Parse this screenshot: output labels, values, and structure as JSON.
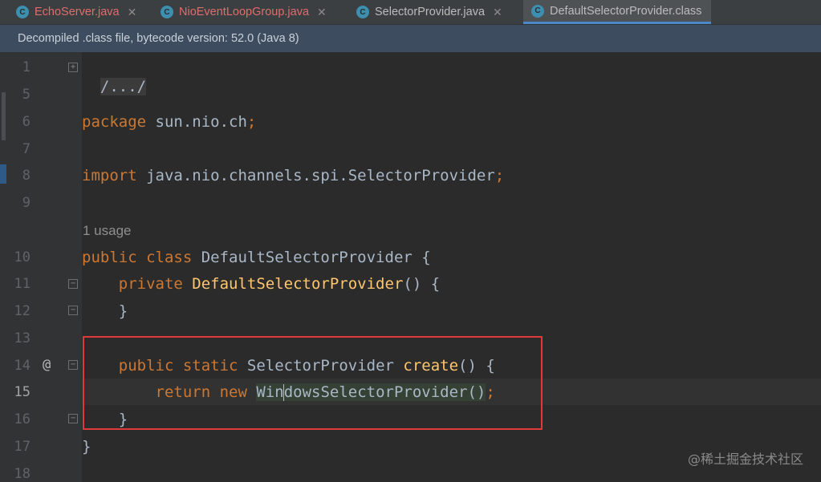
{
  "tabs": [
    {
      "label": "EchoServer.java",
      "state": "error"
    },
    {
      "label": "NioEventLoopGroup.java",
      "state": "error"
    },
    {
      "label": "SelectorProvider.java",
      "state": "normal"
    },
    {
      "label": "DefaultSelectorProvider.class",
      "state": "active"
    }
  ],
  "banner": "Decompiled .class file, bytecode version: 52.0 (Java 8)",
  "line_numbers": [
    "1",
    "5",
    "6",
    "7",
    "8",
    "9",
    "10",
    "11",
    "12",
    "13",
    "14",
    "15",
    "16",
    "17",
    "18"
  ],
  "code": {
    "folded": "/.../",
    "package_kw": "package",
    "package_name": " sun.nio.ch",
    "import_kw": "import",
    "import_name": " java.nio.channels.spi.SelectorProvider",
    "semicolon": ";",
    "usage": "1 usage",
    "class_mods": "public class",
    "class_name": " DefaultSelectorProvider {",
    "ctor_mod": "private",
    "ctor_name": " DefaultSelectorProvider",
    "ctor_rest": "() {",
    "close_brace": "}",
    "create_mods": "public static",
    "create_type": " SelectorProvider ",
    "create_name": "create",
    "create_rest": "() {",
    "return_kw": "return new",
    "new_a": "Win",
    "new_b": "dowsSelectorProvider",
    "new_rest": "()"
  },
  "gutter_marker": "@",
  "watermark": "@稀土掘金技术社区",
  "colors": {
    "keyword": "#cc7832",
    "function": "#ffc66d",
    "text": "#a9b7c6",
    "highlight_box": "#e0393b"
  }
}
